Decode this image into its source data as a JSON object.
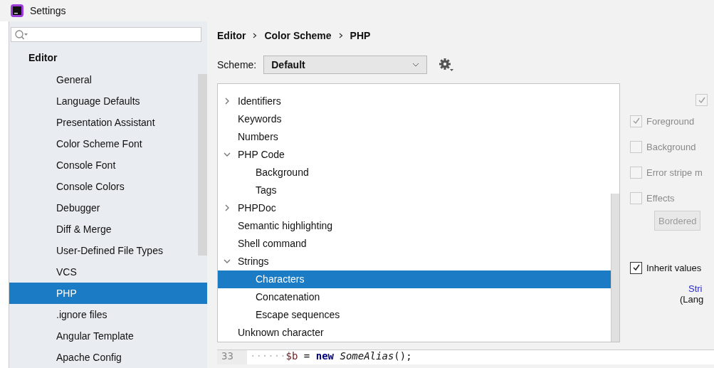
{
  "window": {
    "title": "Settings"
  },
  "sidebar": {
    "section": "Editor",
    "items": [
      {
        "label": "General",
        "selected": false
      },
      {
        "label": "Language Defaults",
        "selected": false
      },
      {
        "label": "Presentation Assistant",
        "selected": false
      },
      {
        "label": "Color Scheme Font",
        "selected": false
      },
      {
        "label": "Console Font",
        "selected": false
      },
      {
        "label": "Console Colors",
        "selected": false
      },
      {
        "label": "Debugger",
        "selected": false
      },
      {
        "label": "Diff & Merge",
        "selected": false
      },
      {
        "label": "User-Defined File Types",
        "selected": false
      },
      {
        "label": "VCS",
        "selected": false
      },
      {
        "label": "PHP",
        "selected": true
      },
      {
        "label": ".ignore files",
        "selected": false
      },
      {
        "label": "Angular Template",
        "selected": false
      },
      {
        "label": "Apache Config",
        "selected": false
      }
    ]
  },
  "breadcrumb": [
    "Editor",
    "Color Scheme",
    "PHP"
  ],
  "scheme": {
    "label": "Scheme:",
    "value": "Default"
  },
  "tree": [
    {
      "label": "Identifiers",
      "expanded": false,
      "selected": false
    },
    {
      "label": "Keywords",
      "selected": false
    },
    {
      "label": "Numbers",
      "selected": false
    },
    {
      "label": "PHP Code",
      "expanded": true,
      "selected": false,
      "children": [
        {
          "label": "Background",
          "selected": false
        },
        {
          "label": "Tags",
          "selected": false
        }
      ]
    },
    {
      "label": "PHPDoc",
      "expanded": false,
      "selected": false
    },
    {
      "label": "Semantic highlighting",
      "selected": false
    },
    {
      "label": "Shell command",
      "selected": false
    },
    {
      "label": "Strings",
      "expanded": true,
      "selected": false,
      "children": [
        {
          "label": "Characters",
          "selected": true
        },
        {
          "label": "Concatenation",
          "selected": false
        },
        {
          "label": "Escape sequences",
          "selected": false
        }
      ]
    },
    {
      "label": "Unknown character",
      "selected": false
    }
  ],
  "options": [
    {
      "label": "Foreground",
      "checked": true,
      "disabled": true
    },
    {
      "label": "Background",
      "checked": false,
      "disabled": true
    },
    {
      "label": "Error stripe m",
      "checked": false,
      "disabled": true
    },
    {
      "label": "Effects",
      "checked": false,
      "disabled": true
    }
  ],
  "top_checkbox": {
    "checked": true,
    "disabled": true
  },
  "effect_button": "Bordered",
  "inherit": {
    "label": "Inherit values",
    "checked": true,
    "disabled": false
  },
  "inherit_link": "Stri",
  "inherit_note": "(Lang",
  "code": {
    "line_number": "33",
    "tokens": [
      {
        "text": "······",
        "kind": "whitespace"
      },
      {
        "text": "$b",
        "kind": "variable"
      },
      {
        "text": " = ",
        "kind": "plain"
      },
      {
        "text": "new",
        "kind": "keyword"
      },
      {
        "text": " SomeAlias",
        "kind": "class"
      },
      {
        "text": "();",
        "kind": "plain"
      }
    ]
  }
}
